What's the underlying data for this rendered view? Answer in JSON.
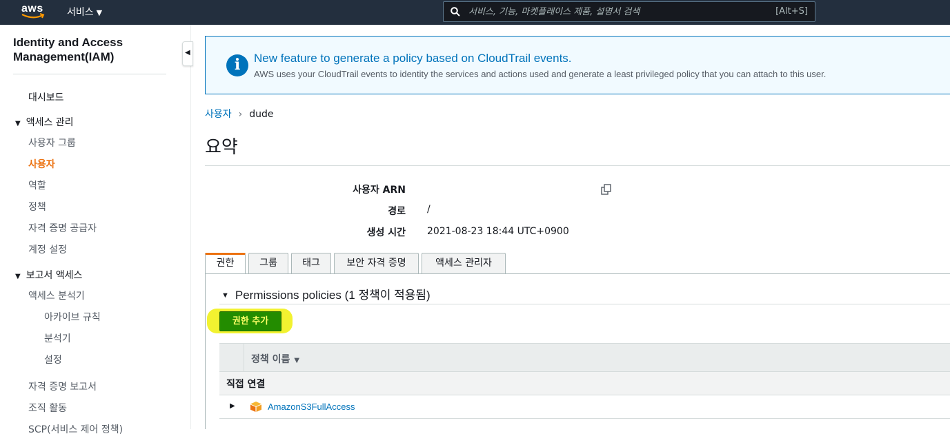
{
  "topnav": {
    "logo_text": "aws",
    "services_label": "서비스",
    "search_placeholder": "서비스, 기능, 마켓플레이스 제품, 설명서 검색",
    "search_shortcut": "[Alt+S]"
  },
  "sidebar": {
    "title": "Identity and Access Management(IAM)",
    "dashboard": "대시보드",
    "access_management": {
      "label": "액세스 관리",
      "items": [
        "사용자 그룹",
        "사용자",
        "역할",
        "정책",
        "자격 증명 공급자",
        "계정 설정"
      ]
    },
    "access_reports": {
      "label": "보고서 액세스",
      "analyzer": "액세스 분석기",
      "analyzer_items": [
        "아카이브 규칙",
        "분석기",
        "설정"
      ],
      "items": [
        "자격 증명 보고서",
        "조직 활동",
        "SCP(서비스 제어 정책)"
      ]
    }
  },
  "banner": {
    "title": "New feature to generate a policy based on CloudTrail events.",
    "body": "AWS uses your CloudTrail events to identity the services and actions used and generate a least privileged policy that you can attach to this user."
  },
  "breadcrumb": {
    "parent": "사용자",
    "separator": "›",
    "current": "dude"
  },
  "summary": {
    "heading": "요약",
    "fields": [
      {
        "label": "사용자 ARN",
        "value": ""
      },
      {
        "label": "경로",
        "value": "/"
      },
      {
        "label": "생성 시간",
        "value": "2021-08-23 18:44 UTC+0900"
      }
    ]
  },
  "tabs": [
    "권한",
    "그룹",
    "태그",
    "보안 자격 증명",
    "액세스 관리자"
  ],
  "permissions": {
    "section_title": "Permissions policies (1 정책이 적용됨)",
    "add_button": "권한 추가",
    "column_policy_name": "정책 이름",
    "group_direct": "직접 연결",
    "policies": [
      "AmazonS3FullAccess"
    ]
  },
  "colors": {
    "nav_bg": "#232f3e",
    "link": "#0073bb",
    "active_orange": "#ec7211",
    "add_button_bg": "#238c00",
    "highlight": "#f2f230"
  }
}
